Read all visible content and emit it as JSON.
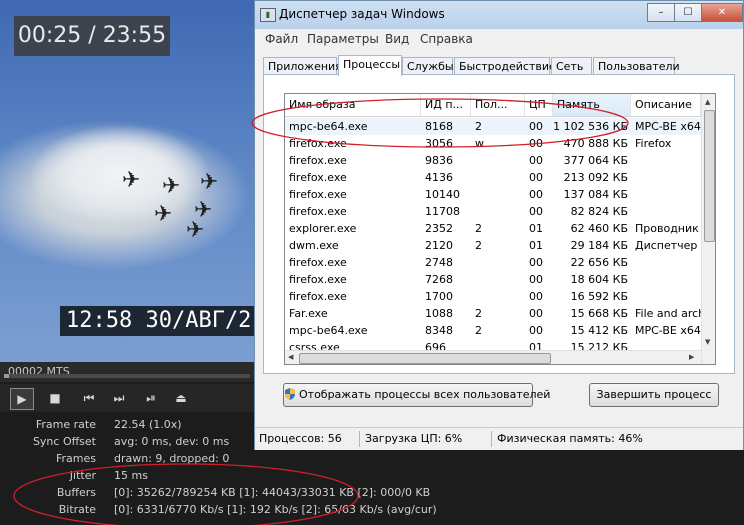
{
  "player": {
    "timecode": "00:25 / 23:55",
    "stamp": "12:58  30/АВГ/2",
    "filename": "00002.MTS",
    "seek_fraction": 0.02,
    "controls": {
      "play": "play-icon",
      "stop": "stop-icon",
      "prev": "skip-back-icon",
      "next": "skip-forward-icon",
      "frame_step": "frame-step-icon",
      "eject": "eject-icon"
    },
    "stats": [
      {
        "label": "Frame rate",
        "value": "22.54  (1.0x)"
      },
      {
        "label": "Sync Offset",
        "value": "avg: 0 ms, dev: 0 ms"
      },
      {
        "label": "Frames",
        "value": "drawn: 9, dropped: 0"
      },
      {
        "label": "Jitter",
        "value": "15 ms"
      },
      {
        "label": "Buffers",
        "value": "[0]: 35262/789254 KB [1]: 44043/33031 KB [2]: 000/0 KB"
      },
      {
        "label": "Bitrate",
        "value": "[0]: 6331/6770 Kb/s [1]: 192 Kb/s [2]: 65/63 Kb/s (avg/cur)"
      }
    ]
  },
  "taskmgr": {
    "title": "Диспетчер задач Windows",
    "window_buttons": {
      "minimize": "–",
      "maximize": "☐",
      "close": "✕"
    },
    "menu": [
      "Файл",
      "Параметры",
      "Вид",
      "Справка"
    ],
    "tabs": [
      "Приложения",
      "Процессы",
      "Службы",
      "Быстродействие",
      "Сеть",
      "Пользователи"
    ],
    "active_tab": "Процессы",
    "columns": [
      "Имя образа",
      "ИД п...",
      "Пол...",
      "ЦП",
      "Память",
      "Описание"
    ],
    "processes": [
      {
        "name": "mpc-be64.exe",
        "pid": "8168",
        "user": "2",
        "cpu": "00",
        "mem": "1 102 536 КБ",
        "desc": "MPC-BE x64"
      },
      {
        "name": "firefox.exe",
        "pid": "3056",
        "user": "w",
        "cpu": "00",
        "mem": "470 888 КБ",
        "desc": "Firefox"
      },
      {
        "name": "firefox.exe",
        "pid": "9836",
        "user": "",
        "cpu": "00",
        "mem": "377 064 КБ",
        "desc": ""
      },
      {
        "name": "firefox.exe",
        "pid": "4136",
        "user": "",
        "cpu": "00",
        "mem": "213 092 КБ",
        "desc": ""
      },
      {
        "name": "firefox.exe",
        "pid": "10140",
        "user": "",
        "cpu": "00",
        "mem": "137 084 КБ",
        "desc": ""
      },
      {
        "name": "firefox.exe",
        "pid": "11708",
        "user": "",
        "cpu": "00",
        "mem": "82 824 КБ",
        "desc": ""
      },
      {
        "name": "explorer.exe",
        "pid": "2352",
        "user": "2",
        "cpu": "01",
        "mem": "62 460 КБ",
        "desc": "Проводник"
      },
      {
        "name": "dwm.exe",
        "pid": "2120",
        "user": "2",
        "cpu": "01",
        "mem": "29 184 КБ",
        "desc": "Диспетчер о"
      },
      {
        "name": "firefox.exe",
        "pid": "2748",
        "user": "",
        "cpu": "00",
        "mem": "22 656 КБ",
        "desc": ""
      },
      {
        "name": "firefox.exe",
        "pid": "7268",
        "user": "",
        "cpu": "00",
        "mem": "18 604 КБ",
        "desc": ""
      },
      {
        "name": "firefox.exe",
        "pid": "1700",
        "user": "",
        "cpu": "00",
        "mem": "16 592 КБ",
        "desc": ""
      },
      {
        "name": "Far.exe",
        "pid": "1088",
        "user": "2",
        "cpu": "00",
        "mem": "15 668 КБ",
        "desc": "File and archi"
      },
      {
        "name": "mpc-be64.exe",
        "pid": "8348",
        "user": "2",
        "cpu": "00",
        "mem": "15 412 КБ",
        "desc": "MPC-BE x64"
      },
      {
        "name": "csrss.exe",
        "pid": "696",
        "user": "",
        "cpu": "01",
        "mem": "15 212 КБ",
        "desc": ""
      }
    ],
    "show_all_button": "Отображать процессы всех пользователей",
    "end_process_button": "Завершить процесс",
    "status": {
      "processes": "Процессов: 56",
      "cpu": "Загрузка ЦП: 6%",
      "memory": "Физическая память: 46%"
    }
  }
}
